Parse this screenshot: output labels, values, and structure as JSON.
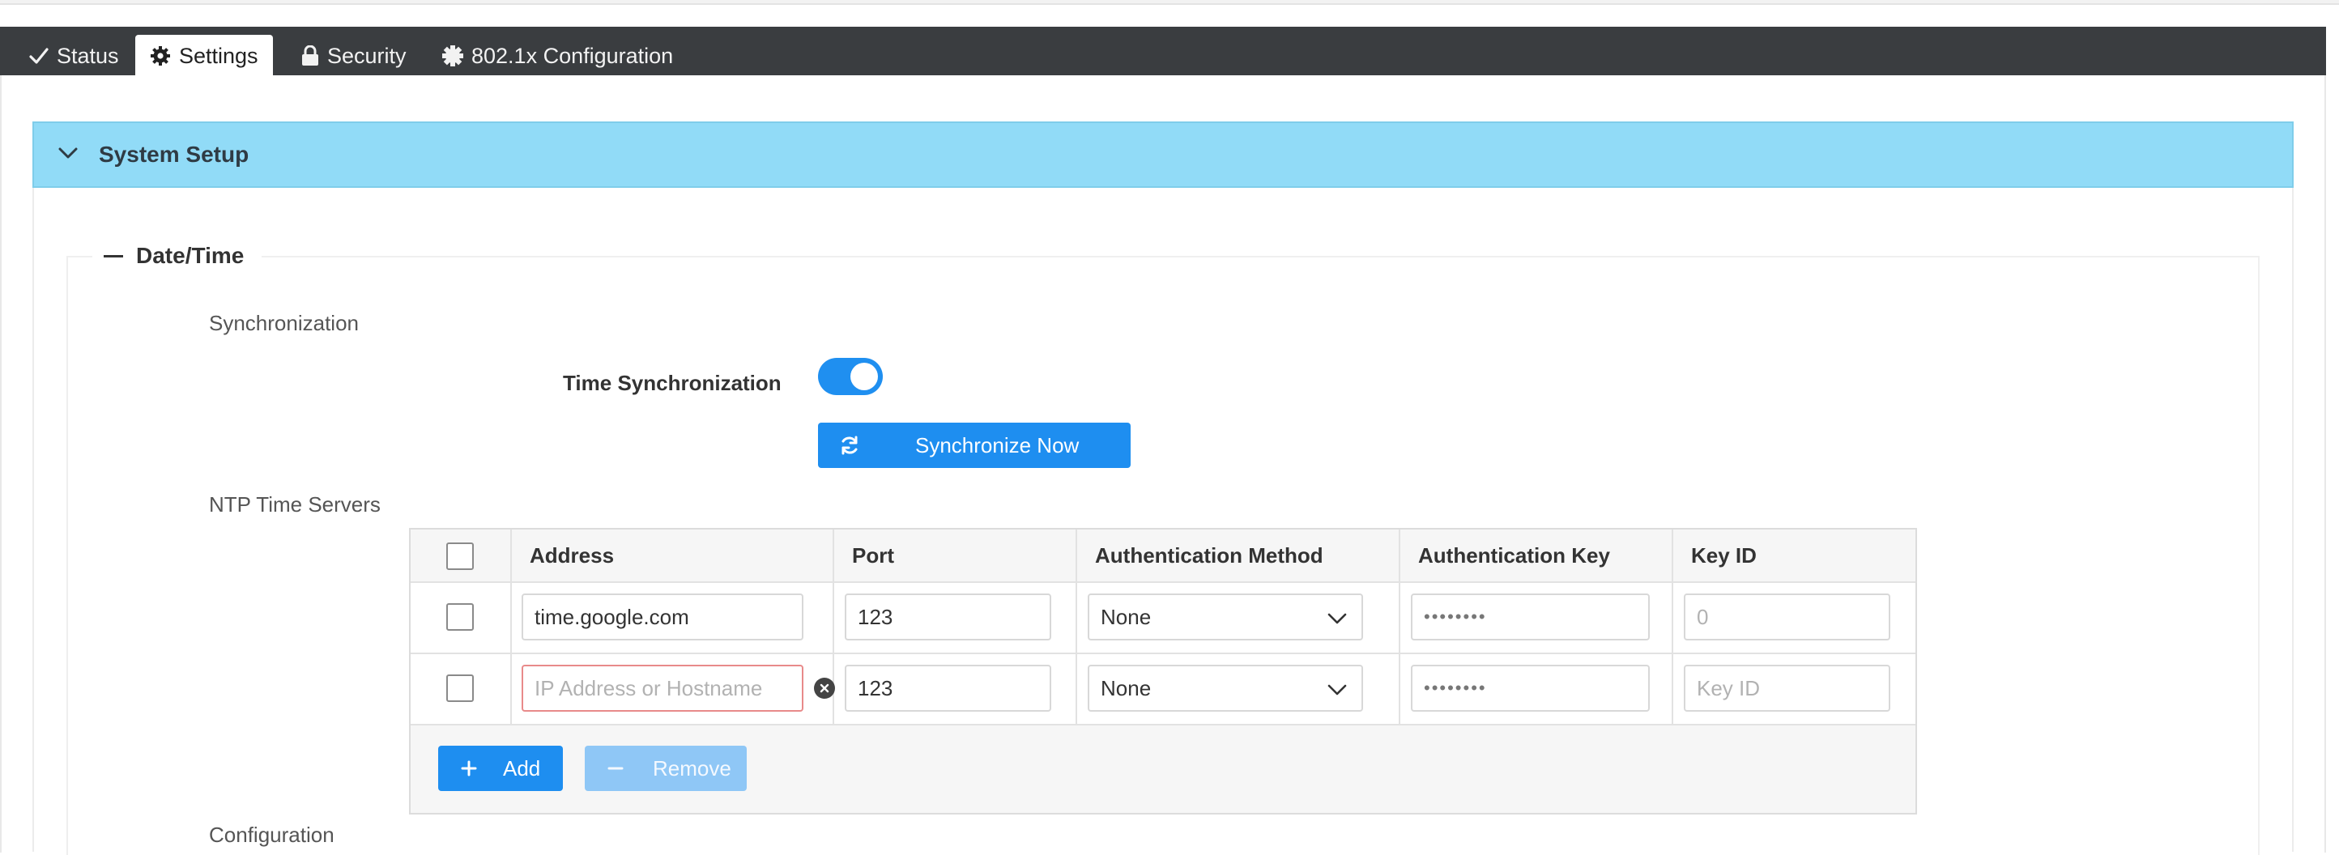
{
  "tabs": [
    {
      "label": "Status",
      "icon": "check-icon"
    },
    {
      "label": "Settings",
      "icon": "gear-icon",
      "active": true
    },
    {
      "label": "Security",
      "icon": "lock-icon"
    },
    {
      "label": "802.1x Configuration",
      "icon": "badge-icon"
    }
  ],
  "panel": {
    "title": "System Setup"
  },
  "datetime": {
    "legend": "Date/Time",
    "sync_section": "Synchronization",
    "time_sync_label": "Time Synchronization",
    "time_sync_enabled": true,
    "sync_now_label": "Synchronize Now",
    "ntp_section": "NTP Time Servers",
    "next_section": "Configuration"
  },
  "ntp_table": {
    "columns": [
      "Address",
      "Port",
      "Authentication Method",
      "Authentication Key",
      "Key ID"
    ],
    "rows": [
      {
        "address": "time.google.com",
        "address_placeholder": "",
        "port": "123",
        "auth_method": "None",
        "auth_key": "••••••••",
        "key_id": "0",
        "key_id_placeholder": "Key ID"
      },
      {
        "address": "",
        "address_placeholder": "IP Address or Hostname",
        "port": "123",
        "auth_method": "None",
        "auth_key": "••••••••",
        "key_id": "",
        "key_id_placeholder": "Key ID"
      }
    ],
    "add_label": "Add",
    "remove_label": "Remove"
  },
  "colors": {
    "tabbar_bg": "#3a3d40",
    "panel_header_bg": "#91dbf7",
    "primary": "#1e8ef0",
    "primary_disabled": "#8fc7f6",
    "error_border": "#e88a8a"
  }
}
